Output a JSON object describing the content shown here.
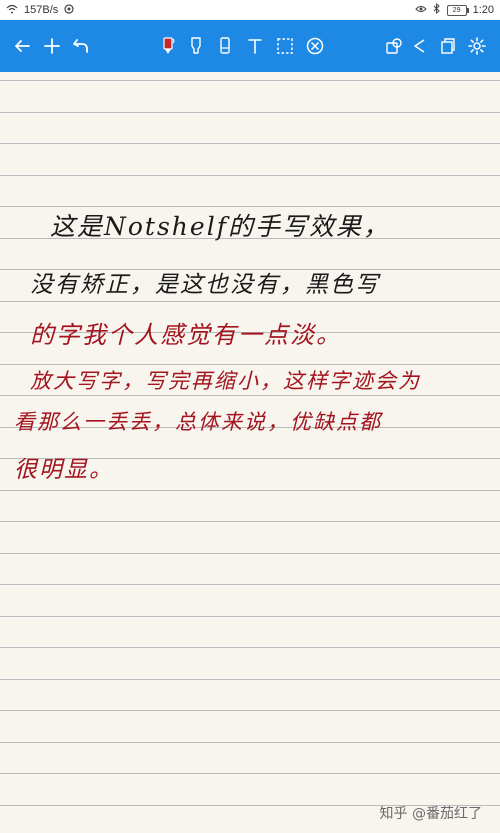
{
  "status_bar": {
    "speed": "157B/s",
    "time": "1:20",
    "battery_level": "29"
  },
  "toolbar": {
    "accent_color": "#1e88e5",
    "left_icons": [
      "back-arrow-icon",
      "add-icon",
      "undo-icon"
    ],
    "tool_icons": [
      "pen-icon",
      "highlighter-icon",
      "eraser-icon",
      "text-icon",
      "lasso-select-icon",
      "clear-icon"
    ],
    "right_icons": [
      "shapes-icon",
      "share-icon",
      "pages-icon",
      "settings-icon"
    ],
    "active_pen_color": "#c62828"
  },
  "note": {
    "lines": [
      {
        "text": "这是Notshelf的手写效果，",
        "color": "#1a1a1a"
      },
      {
        "text": "没有矫正，是这也没有，黑色写",
        "color": "#1a1a1a"
      },
      {
        "text": "的字我个人感觉有一点淡。",
        "color": "#a3141e"
      },
      {
        "text": "放大写字，写完再缩小，这样字迹会为",
        "color": "#a3141e"
      },
      {
        "text": "看那么一丢丢，总体来说，优缺点都",
        "color": "#a3141e"
      },
      {
        "text": "很明显。",
        "color": "#a3141e"
      }
    ]
  },
  "watermark": "知乎 @番茄红了"
}
